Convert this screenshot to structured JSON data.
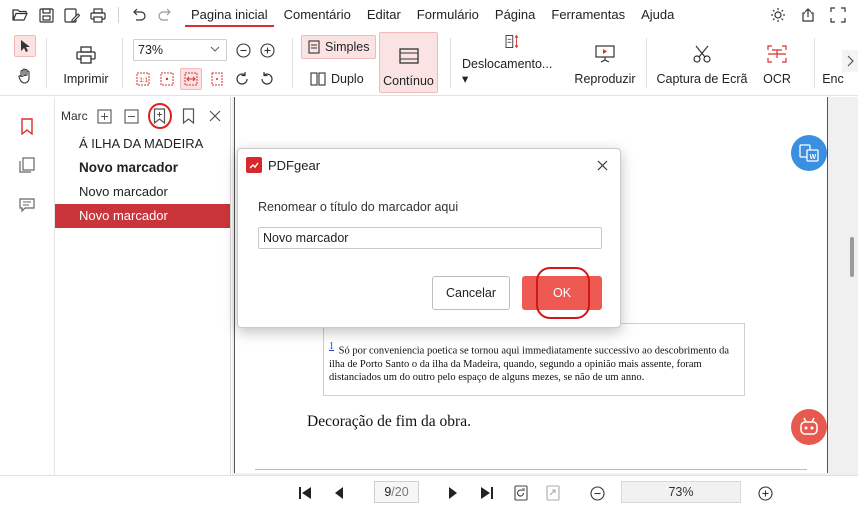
{
  "menubar": {
    "tabs": [
      {
        "label": "Pagina inicial",
        "active": true
      },
      {
        "label": "Comentário"
      },
      {
        "label": "Editar"
      },
      {
        "label": "Formulário"
      },
      {
        "label": "Página"
      },
      {
        "label": "Ferramentas"
      },
      {
        "label": "Ajuda"
      }
    ],
    "quick_access_icons": [
      "open-folder-icon",
      "save-icon",
      "save-as-icon",
      "print-icon",
      "undo-icon",
      "redo-icon"
    ],
    "right_icons": [
      "theme-icon",
      "share-icon",
      "fullscreen-icon"
    ]
  },
  "ribbon": {
    "print_label": "Imprimir",
    "zoom_value": "73%",
    "mode_single": "Simples",
    "mode_double": "Duplo",
    "mode_continuous": "Contínuo",
    "scroll_label": "Deslocamento...",
    "play_label": "Reproduzir",
    "capture_label": "Captura de Ecrã",
    "ocr_label": "OCR",
    "overflow_label": "Enc"
  },
  "panel": {
    "title": "Marcadores",
    "bookmarks": [
      {
        "label": "Á ILHA DA MADEIRA",
        "bold": false,
        "selected": false
      },
      {
        "label": "Novo marcador",
        "bold": true,
        "selected": false
      },
      {
        "label": "Novo marcador",
        "bold": false,
        "selected": false
      },
      {
        "label": "Novo marcador",
        "bold": false,
        "selected": true
      }
    ]
  },
  "document": {
    "footnote_number": "1",
    "footnote_text": "Só por conveniencia poetica se tornou aqui immediatamente successivo ao descobrimento da ilha de Porto Santo o da ilha da Madeira, quando, segundo a opinião mais assente, foram distanciados um do outro pelo espaço de alguns mezes, se não de um anno.",
    "heading": "Decoração de fim da obra."
  },
  "dialog": {
    "title": "PDFgear",
    "prompt": "Renomear o título do marcador aqui",
    "input_value": "Novo marcador",
    "cancel_label": "Cancelar",
    "ok_label": "OK"
  },
  "bottombar": {
    "current_page": "9",
    "total_pages": "/20",
    "zoom": "73%"
  },
  "colors": {
    "accent": "#d9302f",
    "selected_bookmark": "#c9353a",
    "ok_button": "#ee5a52",
    "highlight_circle": "#d01818"
  }
}
